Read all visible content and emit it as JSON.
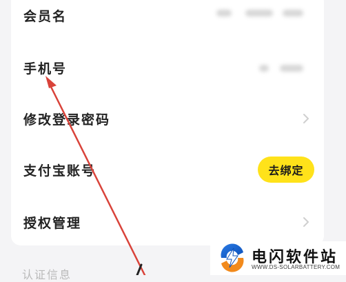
{
  "rows": [
    {
      "label": "会员名"
    },
    {
      "label": "手机号"
    },
    {
      "label": "修改登录密码"
    },
    {
      "label": "支付宝账号",
      "action": "去绑定"
    },
    {
      "label": "授权管理"
    }
  ],
  "section": {
    "title": "认证信息"
  },
  "watermark": {
    "title": "电闪软件站",
    "url": "WWW.DS-SOLARBATTERY.COM"
  },
  "colors": {
    "accent": "#ffe21a",
    "annotation_arrow": "#d9433a",
    "card_bg": "#ffffff",
    "page_bg": "#f4f4f6"
  },
  "icons": {
    "chevron": "chevron-right-icon",
    "logo": "lightning-logo-icon"
  }
}
